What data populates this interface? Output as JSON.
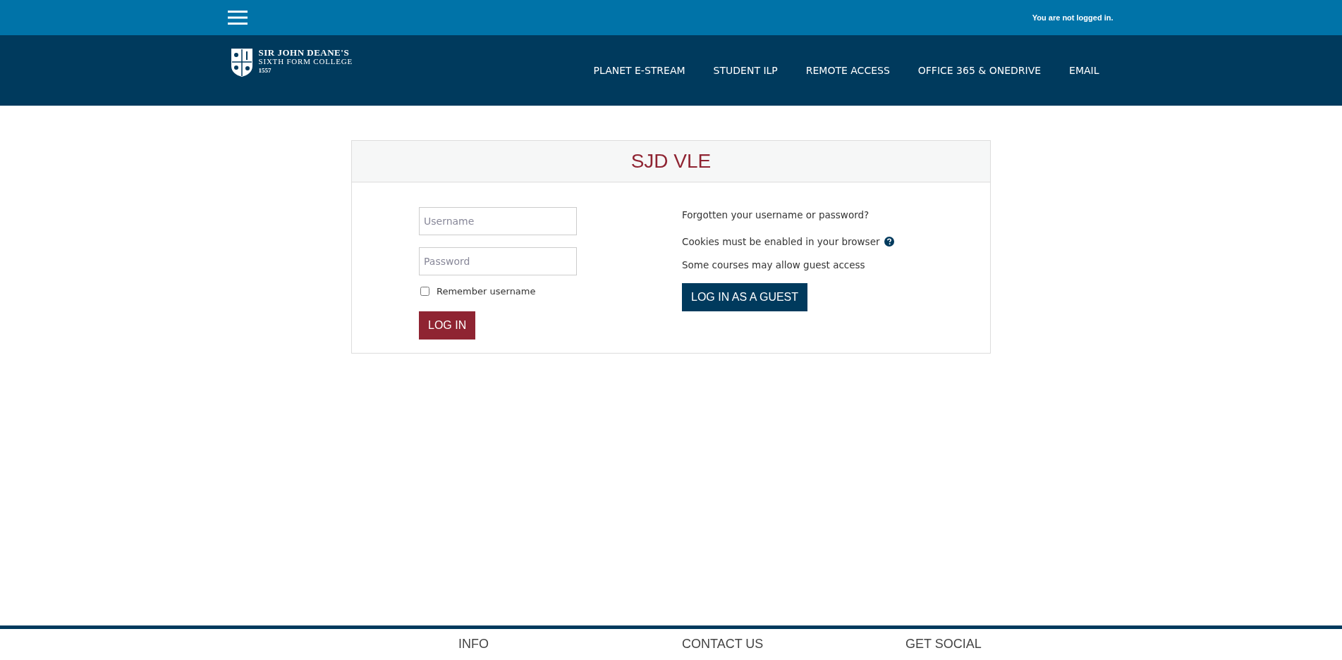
{
  "top_bar": {
    "login_status": "You are not logged in."
  },
  "header": {
    "logo": {
      "line_1": "SIR JOHN DEANE'S",
      "line_2": "SIXTH FORM COLLEGE",
      "line_3": "1557"
    },
    "nav": [
      "PLANET E-STREAM",
      "STUDENT ILP",
      "REMOTE ACCESS",
      "OFFICE 365 & ONEDRIVE",
      "EMAIL"
    ]
  },
  "login_card": {
    "title": "SJD VLE",
    "username": {
      "placeholder": "Username"
    },
    "password": {
      "placeholder": "Password"
    },
    "remember": {
      "label": "Remember username",
      "checked": false
    },
    "login_button": "LOG IN",
    "forgotten_link": "Forgotten your username or password?",
    "cookies_note": "Cookies must be enabled in your browser",
    "guest_note": "Some courses may allow guest access",
    "guest_button": "LOG IN AS A GUEST"
  },
  "footer": {
    "headings": [
      "INFO",
      "CONTACT US",
      "GET SOCIAL"
    ]
  }
}
